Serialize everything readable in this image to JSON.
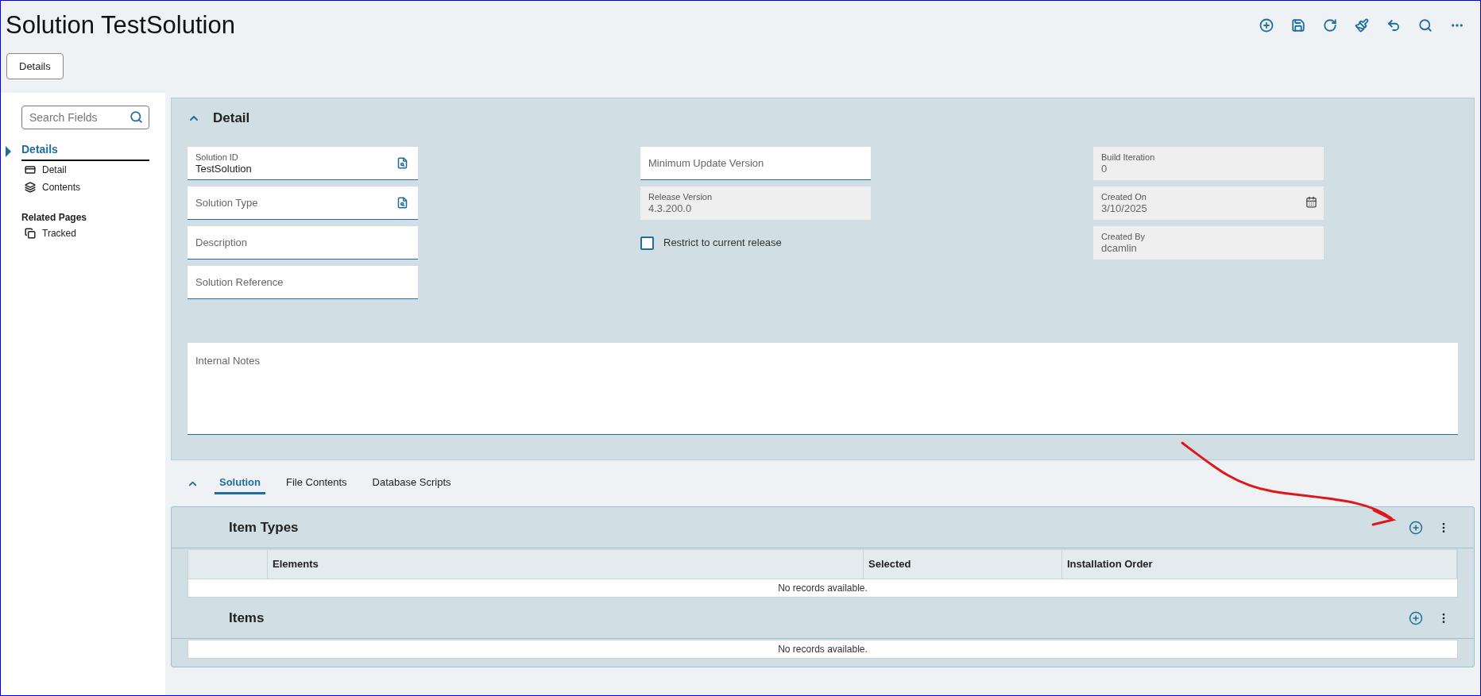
{
  "page": {
    "title": "Solution TestSolution",
    "toolbar": [
      {
        "kind": "add"
      },
      {
        "kind": "save"
      },
      {
        "kind": "refresh"
      },
      {
        "kind": "clear"
      },
      {
        "kind": "undo"
      },
      {
        "kind": "search"
      },
      {
        "kind": "more"
      }
    ]
  },
  "view_buttons": [
    "Details"
  ],
  "sidebar": {
    "search": {
      "placeholder": "Search Fields"
    },
    "sections": [
      {
        "title": "Details",
        "selected": true,
        "items": [
          {
            "label": "Detail",
            "kind": "card"
          },
          {
            "label": "Contents",
            "kind": "layers"
          }
        ]
      },
      {
        "title": "Related Pages",
        "selected": false,
        "items": [
          {
            "label": "Tracked",
            "kind": "pages"
          }
        ]
      }
    ]
  },
  "detail": {
    "title": "Detail",
    "expanded": true,
    "columns": [
      [
        {
          "label": "Solution ID",
          "value": "TestSolution",
          "kind": "lookup"
        },
        {
          "label": "Solution Type",
          "kind": "lookup"
        },
        {
          "label": "Description",
          "kind": "text"
        },
        {
          "label": "Solution Reference",
          "kind": "text"
        }
      ],
      [
        {
          "label": "Minimum Update Version",
          "kind": "text"
        },
        {
          "label": "Release Version",
          "value": "4.3.200.0",
          "kind": "readonly"
        },
        {
          "label": "Restrict to current release",
          "kind": "checkbox",
          "checked": false
        }
      ],
      [
        {
          "label": "Build Iteration",
          "value": "0",
          "kind": "readonly"
        },
        {
          "label": "Created On",
          "value": "3/10/2025",
          "kind": "date"
        },
        {
          "label": "Created By",
          "value": "dcamlin",
          "kind": "readonly"
        }
      ]
    ],
    "notes": {
      "label": "Internal Notes"
    }
  },
  "tabs": {
    "expanded": true,
    "items": [
      {
        "label": "Solution",
        "selected": true
      },
      {
        "label": "File Contents",
        "selected": false
      },
      {
        "label": "Database Scripts",
        "selected": false
      }
    ]
  },
  "grids": [
    {
      "title": "Item Types",
      "columns": [
        "Elements",
        "Selected",
        "Installation Order"
      ],
      "empty_text": "No records available."
    },
    {
      "title": "Items",
      "empty_text": "No records available."
    }
  ],
  "annotation": {
    "kind": "arrow"
  }
}
